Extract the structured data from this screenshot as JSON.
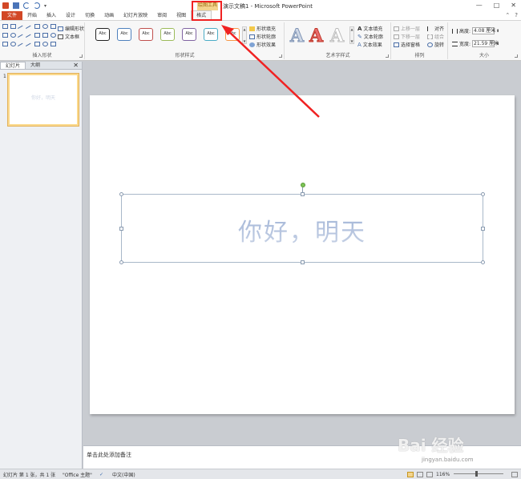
{
  "window": {
    "title": "演示文稿1 - Microsoft PowerPoint",
    "tool_context": "绘图工具",
    "min": "—",
    "max": "□",
    "close": "✕"
  },
  "tabs": [
    {
      "label": "文件"
    },
    {
      "label": "开始"
    },
    {
      "label": "插入"
    },
    {
      "label": "设计"
    },
    {
      "label": "切换"
    },
    {
      "label": "动画"
    },
    {
      "label": "幻灯片放映"
    },
    {
      "label": "审阅"
    },
    {
      "label": "视图"
    },
    {
      "label": "格式"
    }
  ],
  "ribbon": {
    "insert_shapes": {
      "label": "插入形状",
      "edit_shape": "编辑形状",
      "text_box": "文本框"
    },
    "shape_styles": {
      "label": "形状样式",
      "sample": "Abc",
      "styles": [
        {
          "border": "#222222"
        },
        {
          "border": "#4f81bd"
        },
        {
          "border": "#c0504d"
        },
        {
          "border": "#9bbb59"
        },
        {
          "border": "#8064a2"
        },
        {
          "border": "#4bacc6"
        },
        {
          "border": "#f79646"
        }
      ],
      "fill": "形状填充",
      "outline": "形状轮廓",
      "effects": "形状效果"
    },
    "wordart": {
      "label": "艺术字样式",
      "letter": "A",
      "text_fill": "文本填充",
      "text_outline": "文本轮廓",
      "text_effects": "文本效果"
    },
    "arrange": {
      "label": "排列",
      "bring_forward": "上移一层",
      "send_backward": "下移一层",
      "selection_pane": "选择窗格",
      "align": "对齐",
      "group": "组合",
      "rotate": "旋转"
    },
    "size": {
      "label": "大小",
      "height_label": "高度:",
      "height_value": "4.08 厘米",
      "width_label": "宽度:",
      "width_value": "21.59 厘米"
    }
  },
  "left_panel": {
    "tab_slides": "幻灯片",
    "tab_outline": "大纲",
    "close": "✕",
    "slide_number": "1",
    "thumb_text": "你好，明天"
  },
  "slide": {
    "text": "你好，明天"
  },
  "notes": {
    "placeholder": "单击此处添加备注"
  },
  "status": {
    "slide_info": "幻灯片 第 1 张，共 1 张",
    "theme": "\"Office 主题\"",
    "language": "中文(中国)",
    "zoom": "116%"
  },
  "watermark": {
    "main": "Bai 经验",
    "sub": "jingyan.baidu.com"
  },
  "colors": {
    "file_tab": "#d24726",
    "annotation_red": "#f02222",
    "context_tab": "#f3d48e"
  }
}
